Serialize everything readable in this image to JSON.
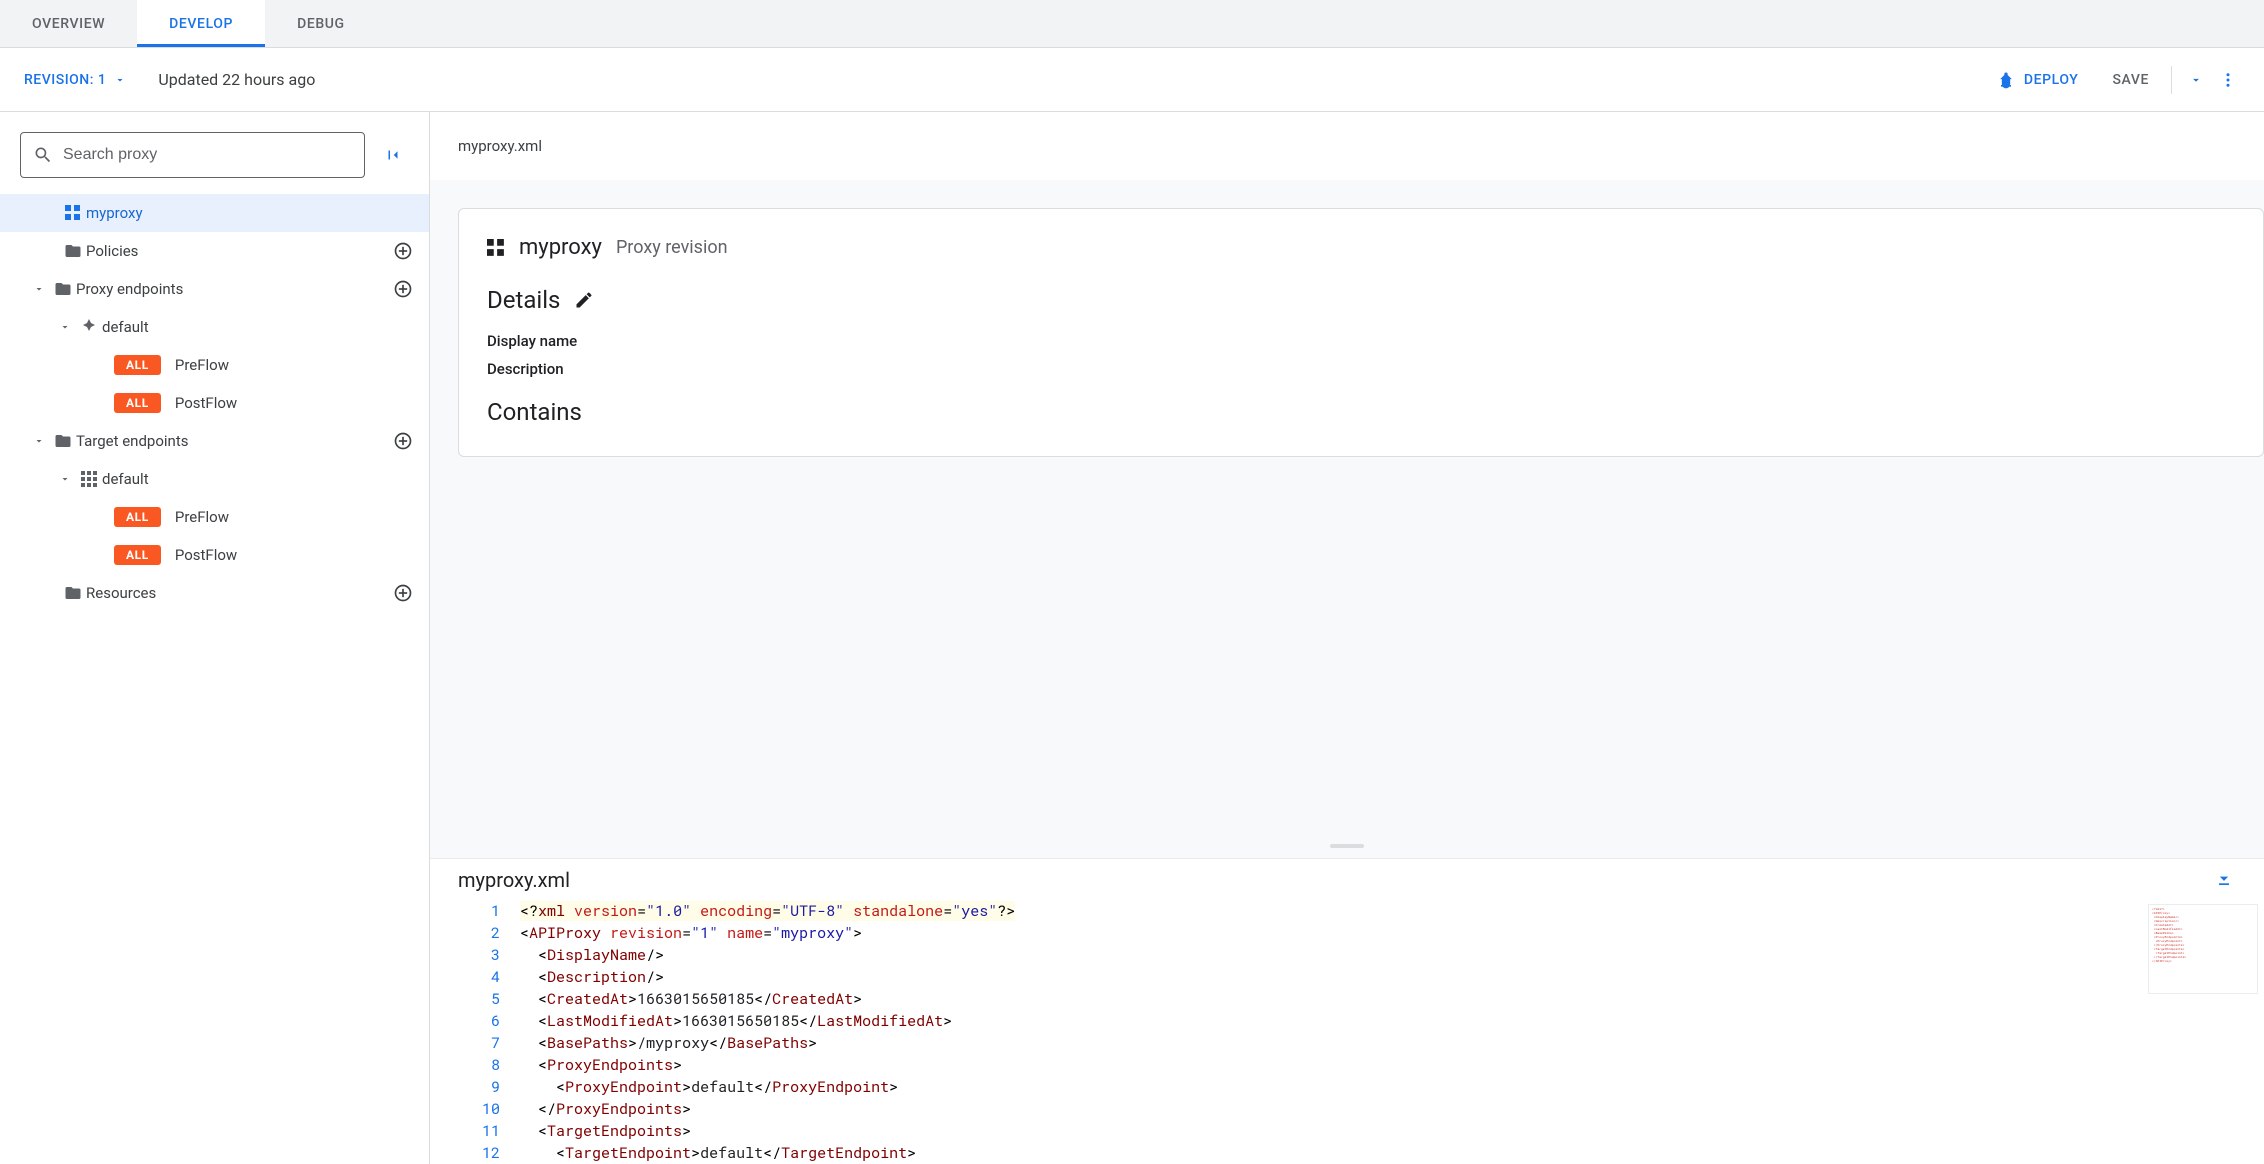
{
  "tabs": {
    "overview": "OVERVIEW",
    "develop": "DEVELOP",
    "debug": "DEBUG",
    "active": "develop"
  },
  "action_bar": {
    "revision_label": "REVISION: 1",
    "updated_text": "Updated 22 hours ago",
    "deploy_label": "DEPLOY",
    "save_label": "SAVE"
  },
  "sidebar": {
    "search_placeholder": "Search proxy",
    "tree": {
      "root_proxy": "myproxy",
      "policies": "Policies",
      "proxy_endpoints": "Proxy endpoints",
      "target_endpoints": "Target endpoints",
      "resources": "Resources",
      "default_label": "default",
      "all_badge": "ALL",
      "preflow": "PreFlow",
      "postflow": "PostFlow"
    }
  },
  "content": {
    "breadcrumb": "myproxy.xml",
    "card": {
      "title": "myproxy",
      "subtitle": "Proxy revision",
      "details_heading": "Details",
      "display_name_label": "Display name",
      "description_label": "Description",
      "contains_heading": "Contains"
    },
    "editor": {
      "filename": "myproxy.xml",
      "xml": {
        "revision": "1",
        "name": "myproxy",
        "created_at": "1663015650185",
        "last_modified_at": "1663015650185",
        "base_path": "/myproxy",
        "proxy_endpoint": "default",
        "target_endpoint": "default"
      }
    }
  }
}
